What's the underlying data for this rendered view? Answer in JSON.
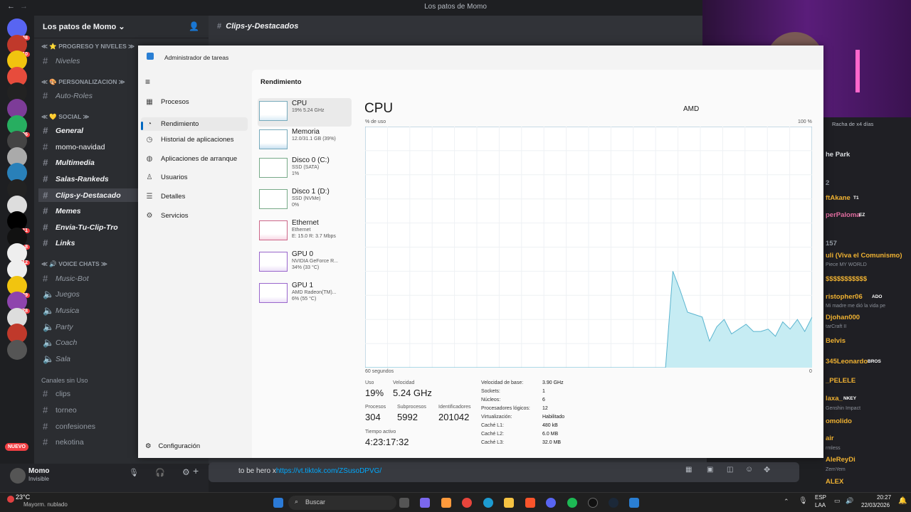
{
  "window_title": "Los patos de Momo",
  "server_badges": [
    "48",
    "10",
    "",
    "",
    "",
    "",
    "196",
    "",
    "",
    "",
    "",
    "",
    "11",
    "8",
    "12",
    "",
    "29",
    "78",
    "",
    "",
    ""
  ],
  "guild_name": "Los patos de Momo",
  "channel_header": "Clips-y-Destacados",
  "categories": {
    "progreso": "PROGRESO Y NIVELES",
    "personal": "PERSONALIZACION",
    "social": "SOCIAL",
    "voice": "VOICE CHATS",
    "sinuso": "Canales sin Uso"
  },
  "channels": {
    "niveles": "Niveles",
    "autoroles": "Auto-Roles",
    "general": "General",
    "navidad": "momo-navidad",
    "multimedia": "Multimedia",
    "rankeds": "Salas-Rankeds",
    "clips": "Clips-y-Destacado",
    "memes": "Memes",
    "envia": "Envia-Tu-Clip-Tro",
    "links": "Links",
    "musicbot": "Music-Bot",
    "juegos": "Juegos",
    "musica": "Musica",
    "party": "Party",
    "coach": "Coach",
    "sala": "Sala",
    "c1": "clips",
    "c2": "torneo",
    "c3": "confesiones",
    "c4": "nekotina"
  },
  "user": {
    "name": "Momo",
    "status": "Invisible"
  },
  "new_badge": "NUEVO",
  "message_input": {
    "text": "to be hero x",
    "url": "https://vt.tiktok.com/ZSusoDPVG/"
  },
  "taskmanager": {
    "title": "Administrador de tareas",
    "nav": [
      "Procesos",
      "Rendimiento",
      "Historial de aplicaciones",
      "Aplicaciones de arranque",
      "Usuarios",
      "Detalles",
      "Servicios"
    ],
    "settings": "Configuración",
    "section": "Rendimiento",
    "devices": [
      {
        "name": "CPU",
        "s1": "19%  5.24 GHz",
        "s2": ""
      },
      {
        "name": "Memoria",
        "s1": "12.0/31.1 GB (39%)",
        "s2": ""
      },
      {
        "name": "Disco 0 (C:)",
        "s1": "SSD (SATA)",
        "s2": "1%"
      },
      {
        "name": "Disco 1 (D:)",
        "s1": "SSD (NVMe)",
        "s2": "0%"
      },
      {
        "name": "Ethernet",
        "s1": "Ethernet",
        "s2": "E: 15.0  R: 3.7 Mbps"
      },
      {
        "name": "GPU 0",
        "s1": "NVIDIA GeForce R...",
        "s2": "34% (33 °C)"
      },
      {
        "name": "GPU 1",
        "s1": "AMD Radeon(TM)...",
        "s2": "6% (55 °C)"
      }
    ],
    "cpu_title": "CPU",
    "cpu_model": "AMD",
    "graph": {
      "ylabel": "% de uso",
      "ymax": "100 %",
      "xlabel": "60 segundos",
      "zero": "0"
    },
    "cpu_usage_history": [
      0,
      0,
      0,
      0,
      0,
      0,
      0,
      0,
      0,
      0,
      0,
      0,
      0,
      0,
      0,
      0,
      0,
      0,
      0,
      0,
      0,
      0,
      0,
      0,
      0,
      0,
      0,
      0,
      0,
      0,
      0,
      0,
      0,
      0,
      0,
      0,
      0,
      0,
      0,
      0,
      0,
      0,
      40,
      32,
      23,
      22,
      21,
      11,
      17,
      20,
      14,
      16,
      18,
      15,
      15,
      16,
      13,
      19,
      16,
      20,
      15,
      21
    ],
    "stats": {
      "uso_l": "Uso",
      "uso": "19%",
      "vel_l": "Velocidad",
      "vel": "5.24 GHz",
      "proc_l": "Procesos",
      "proc": "304",
      "sub_l": "Subprocesos",
      "sub": "5992",
      "ids_l": "Identificadores",
      "ids": "201042",
      "tiempo_l": "Tiempo activo",
      "tiempo": "4:23:17:32"
    },
    "details": [
      [
        "Velocidad de base:",
        "3.90 GHz"
      ],
      [
        "Sockets:",
        "1"
      ],
      [
        "Núcleos:",
        "6"
      ],
      [
        "Procesadores lógicos:",
        "12"
      ],
      [
        "Virtualización:",
        "Habilitado"
      ],
      [
        "Caché L1:",
        "480 kB"
      ],
      [
        "Caché L2:",
        "6.0 MB"
      ],
      [
        "Caché L3:",
        "32.0 MB"
      ]
    ]
  },
  "right_col": [
    {
      "t": "Racha de x4 días",
      "c": "#b5bac1"
    },
    {
      "t": "he Park",
      "c": "#dbdee1"
    },
    {
      "t": "2",
      "c": "#949ba4"
    },
    {
      "t": "ftAkane",
      "c": "#f0b232"
    },
    {
      "t": "perPaloma",
      "c": "#e06c9f"
    },
    {
      "t": "157",
      "c": "#949ba4"
    },
    {
      "t": "uli (Viva el Comunismo)",
      "c": "#f0b232"
    },
    {
      "t": "$$$$$$$$$$$",
      "c": "#f0b232"
    },
    {
      "t": "ristopher06",
      "c": "#f0b232"
    },
    {
      "t": "Djohan000",
      "c": "#f0b232"
    },
    {
      "t": "Belvis",
      "c": "#f0b232"
    },
    {
      "t": "345Leonardo",
      "c": "#f0b232"
    },
    {
      "t": "_PELELE",
      "c": "#f0b232"
    },
    {
      "t": "laxa_",
      "c": "#f0b232"
    },
    {
      "t": "omolido",
      "c": "#f0b232"
    },
    {
      "t": "air",
      "c": "#f0b232"
    },
    {
      "t": "AleReyDi",
      "c": "#f0b232"
    },
    {
      "t": "ALEX",
      "c": "#f0b232"
    }
  ],
  "right_sub": [
    "Piece MY WORLD",
    "Mi madre me dió la vida pe",
    "tarCraft II",
    "Genshin Impact",
    "rmless",
    "ZemYem"
  ],
  "tags": {
    "t1": "T1",
    "ez": "EZ",
    "ado": "ADO",
    "bros": "BROS",
    "nkey": "NKEY"
  },
  "taskbar": {
    "temp": "23°C",
    "weather": "Mayorm. nublado",
    "search": "Buscar",
    "lang": "ESP",
    "lang2": "LAA",
    "time": "20:27",
    "date": "22/03/2026"
  }
}
